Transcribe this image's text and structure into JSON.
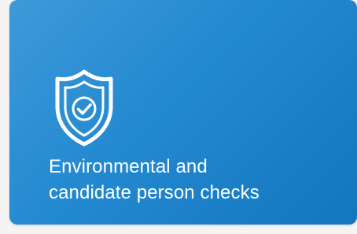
{
  "card": {
    "icon": "shield-check-icon",
    "title_line1": "Environmental and",
    "title_line2": "candidate person checks",
    "background_color": "#2389d0",
    "text_color": "#ffffff"
  }
}
